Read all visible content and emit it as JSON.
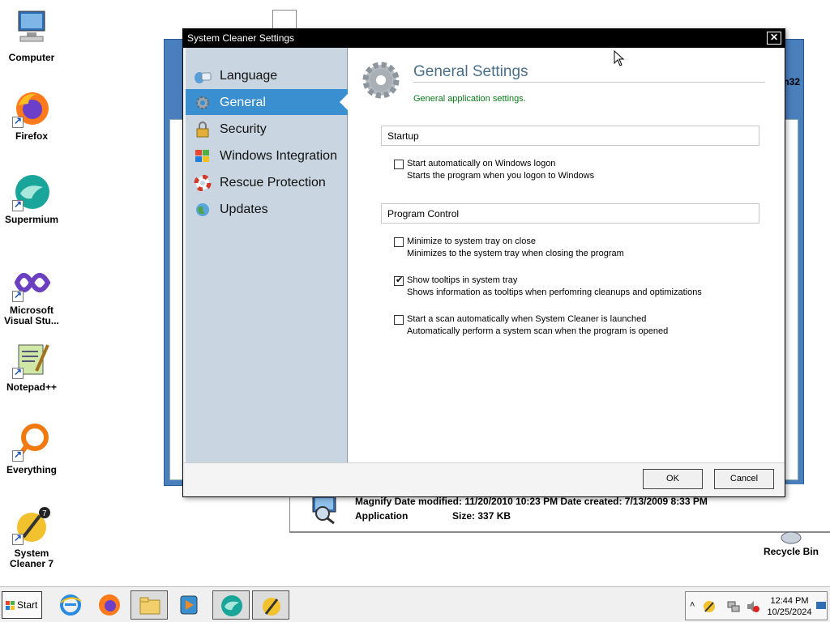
{
  "desktop": {
    "icons": [
      {
        "label": "Computer"
      },
      {
        "label": "Firefox"
      },
      {
        "label": "Supermium"
      },
      {
        "label": "Microsoft Visual Stu..."
      },
      {
        "label": "Notepad++"
      },
      {
        "label": "Everything"
      },
      {
        "label": "System Cleaner 7"
      },
      {
        "label": "Recycle Bin"
      }
    ]
  },
  "background_window": {
    "partial_title": "m32",
    "file_info": {
      "line1": "Magnify   Date modified: 11/20/2010 10:23 PM   Date created: 7/13/2009 8:33 PM",
      "line2_type": "Application",
      "line2_size": "Size: 337 KB"
    }
  },
  "dialog": {
    "title": "System Cleaner  Settings",
    "close_label": "✕",
    "nav": [
      {
        "label": "Language",
        "icon": "language-icon"
      },
      {
        "label": "General",
        "icon": "gear-icon",
        "active": true
      },
      {
        "label": "Security",
        "icon": "lock-icon"
      },
      {
        "label": "Windows Integration",
        "icon": "windows-icon"
      },
      {
        "label": "Rescue Protection",
        "icon": "lifebuoy-icon"
      },
      {
        "label": "Updates",
        "icon": "globe-icon"
      }
    ],
    "content": {
      "title": "General Settings",
      "subtitle": "General application settings.",
      "groups": {
        "startup": "Startup",
        "program_control": "Program Control"
      },
      "options": {
        "autostart": {
          "label": "Start automatically on Windows logon",
          "desc": "Starts the program when you logon to Windows",
          "checked": false
        },
        "minimize_tray": {
          "label": "Minimize to system tray on close",
          "desc": "Minimizes to the system tray when closing the program",
          "checked": false
        },
        "tooltips": {
          "label": "Show tooltips in system tray",
          "desc": "Shows information as tooltips when perfomring cleanups and optimizations",
          "checked": true
        },
        "auto_scan": {
          "label": "Start a scan automatically when System Cleaner is launched",
          "desc": "Automatically perform a system scan when the program is opened",
          "checked": false
        }
      }
    },
    "buttons": {
      "ok": "OK",
      "cancel": "Cancel"
    }
  },
  "taskbar": {
    "start_label": "Start",
    "clock_time": "12:44 PM",
    "clock_date": "10/25/2024"
  },
  "colors": {
    "sidebar_bg": "#c9d5e0",
    "nav_active": "#3a8fd0",
    "subtitle_green": "#0a7a1a",
    "title_blue": "#4a7089"
  }
}
